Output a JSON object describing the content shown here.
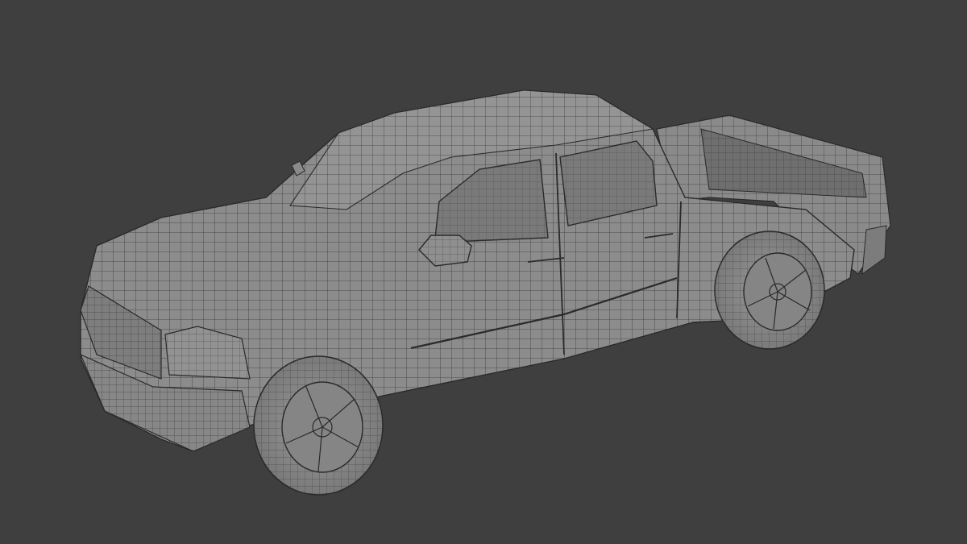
{
  "viewport": {
    "background_color": "#3f3f3f",
    "mesh_fill_color": "#8c8c8c",
    "mesh_shadow_color": "#6a6a6a",
    "wire_color": "#2a2a2a",
    "shading": "solid-wireframe",
    "subject": "pickup-truck-mesh"
  }
}
